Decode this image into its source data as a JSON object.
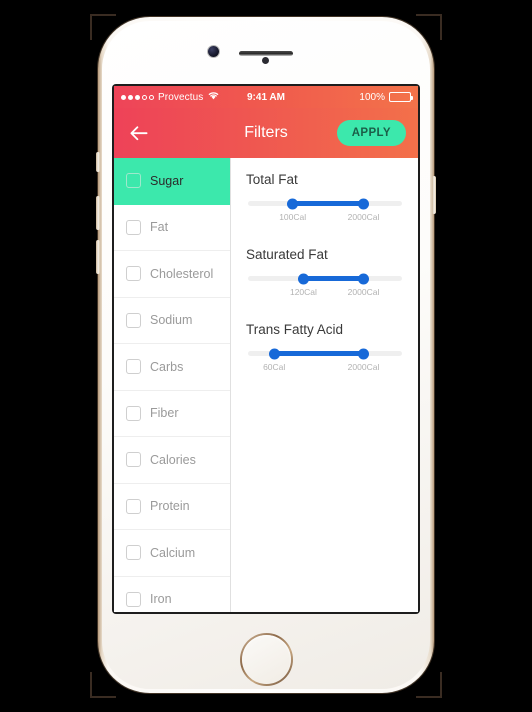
{
  "status_bar": {
    "carrier": "Provectus",
    "signal_dots_filled": 3,
    "signal_dots_total": 5,
    "wifi_icon": "wifi-icon",
    "time": "9:41 AM",
    "battery_percent": "100%"
  },
  "app_bar": {
    "back_icon": "arrow-left-icon",
    "title": "Filters",
    "apply_label": "APPLY"
  },
  "colors": {
    "header_gradient_start": "#ee4258",
    "header_gradient_end": "#f3704a",
    "accent_mint": "#3ce8ac",
    "slider_blue": "#1769d8",
    "track_gray": "#efefef"
  },
  "sidebar": {
    "items": [
      {
        "label": "Sugar",
        "checked": false,
        "selected": true
      },
      {
        "label": "Fat",
        "checked": false,
        "selected": false
      },
      {
        "label": "Cholesterol",
        "checked": false,
        "selected": false
      },
      {
        "label": "Sodium",
        "checked": false,
        "selected": false
      },
      {
        "label": "Carbs",
        "checked": false,
        "selected": false
      },
      {
        "label": "Fiber",
        "checked": false,
        "selected": false
      },
      {
        "label": "Calories",
        "checked": false,
        "selected": false
      },
      {
        "label": "Protein",
        "checked": false,
        "selected": false
      },
      {
        "label": "Calcium",
        "checked": false,
        "selected": false
      },
      {
        "label": "Iron",
        "checked": false,
        "selected": false
      }
    ]
  },
  "panel": {
    "filters": [
      {
        "title": "Total Fat",
        "min_label": "100Cal",
        "max_label": "2000Cal",
        "min_pos": 29,
        "max_pos": 75
      },
      {
        "title": "Saturated Fat",
        "min_label": "120Cal",
        "max_label": "2000Cal",
        "min_pos": 36,
        "max_pos": 75
      },
      {
        "title": "Trans Fatty Acid",
        "min_label": "60Cal",
        "max_label": "2000Cal",
        "min_pos": 17,
        "max_pos": 75
      }
    ]
  }
}
